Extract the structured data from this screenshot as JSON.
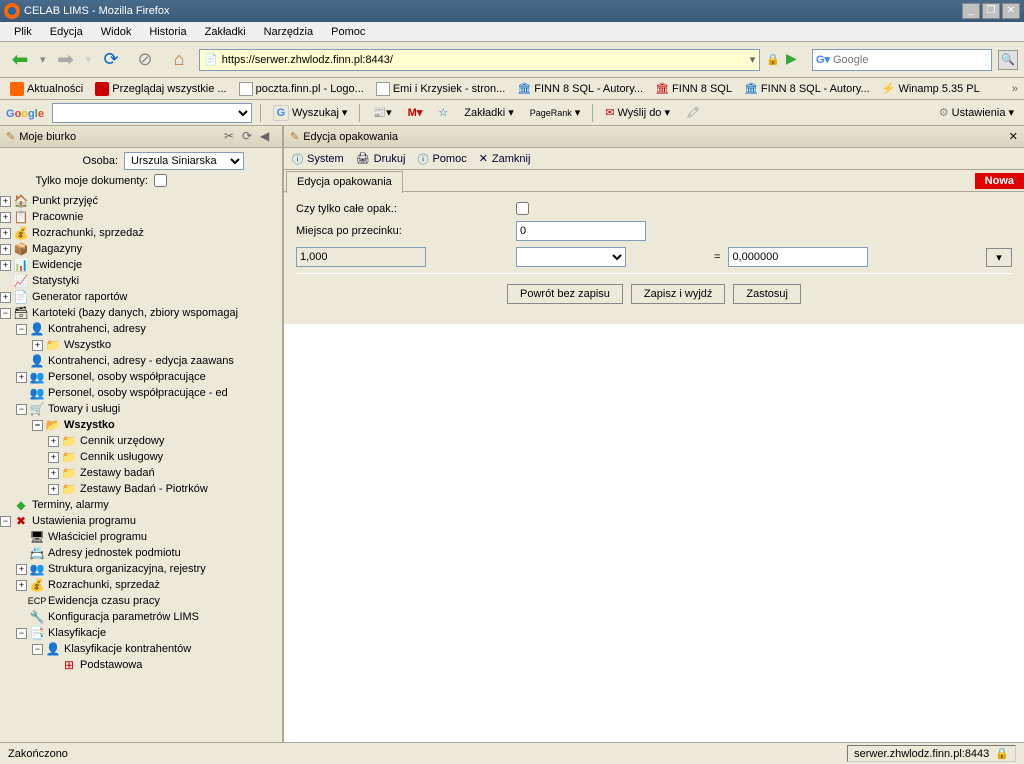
{
  "window": {
    "title": "CELAB LIMS - Mozilla Firefox"
  },
  "menu": {
    "file": "Plik",
    "edit": "Edycja",
    "view": "Widok",
    "history": "Historia",
    "bookmarks": "Zakładki",
    "tools": "Narzędzia",
    "help": "Pomoc"
  },
  "url": "https://serwer.zhwlodz.finn.pl:8443/",
  "search": {
    "placeholder": "Google"
  },
  "bookmarks": {
    "b1": "Aktualności",
    "b2": "Przeglądaj wszystkie ...",
    "b3": "poczta.finn.pl - Logo...",
    "b4": "Emi i Krzysiek - stron...",
    "b5": "FINN 8 SQL - Autory...",
    "b6": "FINN 8 SQL",
    "b7": "FINN 8 SQL - Autory...",
    "b8": "Winamp 5.35 PL"
  },
  "gbar": {
    "search": "Wyszukaj",
    "bookmarks": "Zakładki",
    "pagerank": "PageRank",
    "send": "Wyślij do",
    "settings": "Ustawienia"
  },
  "sidebar": {
    "title": "Moje biurko",
    "person_label": "Osoba:",
    "person_value": "Urszula Siniarska",
    "mydocs_label": "Tylko moje dokumenty:",
    "tree": {
      "n1": "Punkt przyjęć",
      "n2": "Pracownie",
      "n3": "Rozrachunki, sprzedaż",
      "n4": "Magazyny",
      "n5": "Ewidencje",
      "n6": "Statystyki",
      "n7": "Generator raportów",
      "n8": "Kartoteki (bazy danych, zbiory wspomagaj",
      "n8a": "Kontrahenci, adresy",
      "n8a1": "Wszystko",
      "n8b": "Kontrahenci, adresy - edycja zaawans",
      "n8c": "Personel, osoby współpracujące",
      "n8d": "Personel, osoby współpracujące - ed",
      "n8e": "Towary i usługi",
      "n8e1": "Wszystko",
      "n8e1a": "Cennik urzędowy",
      "n8e1b": "Cennik usługowy",
      "n8e1c": "Zestawy badań",
      "n8e1d": "Zestawy Badań - Piotrków",
      "n9": "Terminy, alarmy",
      "n10": "Ustawienia programu",
      "n10a": "Właściciel programu",
      "n10b": "Adresy jednostek podmiotu",
      "n10c": "Struktura organizacyjna, rejestry",
      "n10d": "Rozrachunki, sprzedaż",
      "n10e": "Ewidencja czasu pracy",
      "n10f": "Konfiguracja parametrów LIMS",
      "n10g": "Klasyfikacje",
      "n10g1": "Klasyfikacje kontrahentów",
      "n10g1a": "Podstawowa"
    }
  },
  "content": {
    "title": "Edycja opakowania",
    "toolbar": {
      "system": "System",
      "print": "Drukuj",
      "help": "Pomoc",
      "close": "Zamknij"
    },
    "tab": "Edycja opakowania",
    "flag_new": "Nowa",
    "form": {
      "whole_only": "Czy tylko całe opak.:",
      "decimals": "Miejsca po przecinku:",
      "decimals_val": "0",
      "factor": "1,000",
      "result": "0,000000",
      "eq": "="
    },
    "buttons": {
      "cancel": "Powrót bez zapisu",
      "saveclose": "Zapisz i wyjdź",
      "apply": "Zastosuj"
    }
  },
  "status": {
    "done": "Zakończono",
    "host": "serwer.zhwlodz.finn.pl:8443"
  }
}
